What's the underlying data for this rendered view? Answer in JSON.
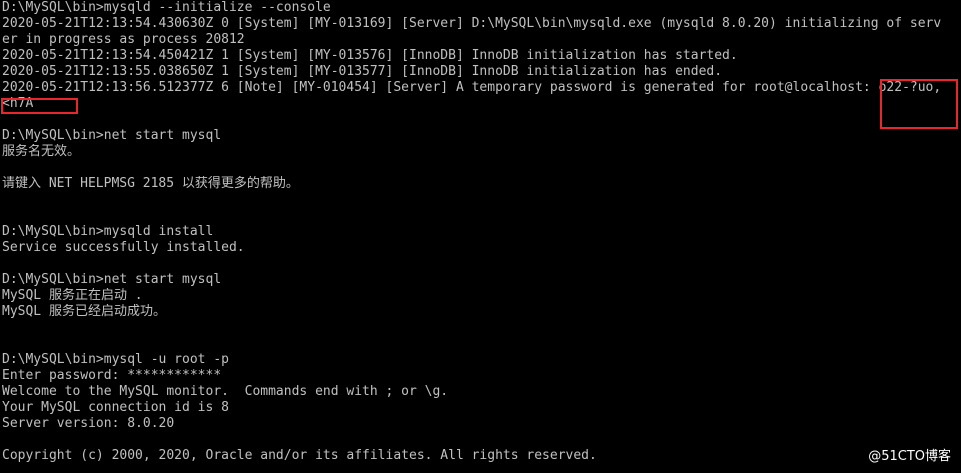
{
  "console": {
    "lines": [
      "D:\\MySQL\\bin>mysqld --initialize --console",
      "2020-05-21T12:13:54.430630Z 0 [System] [MY-013169] [Server] D:\\MySQL\\bin\\mysqld.exe (mysqld 8.0.20) initializing of serv",
      "er in progress as process 20812",
      "2020-05-21T12:13:54.450421Z 1 [System] [MY-013576] [InnoDB] InnoDB initialization has started.",
      "2020-05-21T12:13:55.038650Z 1 [System] [MY-013577] [InnoDB] InnoDB initialization has ended.",
      "2020-05-21T12:13:56.512377Z 6 [Note] [MY-010454] [Server] A temporary password is generated for root@localhost: o22-?uo,",
      "<h7A",
      "",
      "D:\\MySQL\\bin>net start mysql",
      "服务名无效。",
      "",
      "请键入 NET HELPMSG 2185 以获得更多的帮助。",
      "",
      "",
      "D:\\MySQL\\bin>mysqld install",
      "Service successfully installed.",
      "",
      "D:\\MySQL\\bin>net start mysql",
      "MySQL 服务正在启动 .",
      "MySQL 服务已经启动成功。",
      "",
      "",
      "D:\\MySQL\\bin>mysql -u root -p",
      "Enter password: ************",
      "Welcome to the MySQL monitor.  Commands end with ; or \\g.",
      "Your MySQL connection id is 8",
      "Server version: 8.0.20",
      "",
      "Copyright (c) 2000, 2020, Oracle and/or its affiliates. All rights reserved."
    ]
  },
  "watermark": "@51CTO博客"
}
